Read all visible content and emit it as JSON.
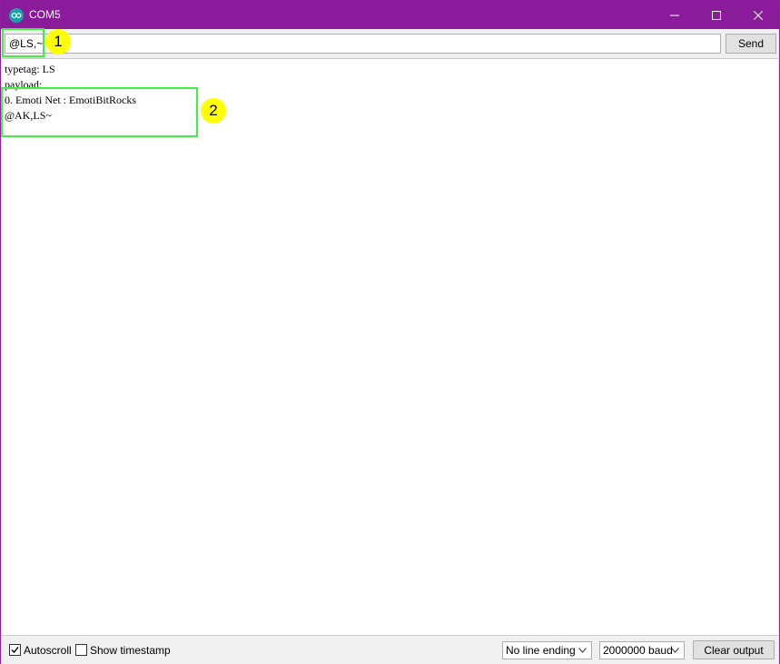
{
  "window": {
    "title": "COM5"
  },
  "input": {
    "value": "@LS,~",
    "send_label": "Send"
  },
  "output": {
    "lines": [
      "typetag: LS",
      "payload:",
      "0. Emoti Net : EmotiBitRocks",
      "@AK,LS~"
    ]
  },
  "statusbar": {
    "autoscroll_label": "Autoscroll",
    "autoscroll_checked": true,
    "timestamp_label": "Show timestamp",
    "timestamp_checked": false,
    "line_ending": "No line ending",
    "baud": "2000000 baud",
    "clear_label": "Clear output"
  },
  "annotations": {
    "marker1": "1",
    "marker2": "2",
    "highlight_color": "#3df23d",
    "marker_color": "#ffff00"
  },
  "colors": {
    "titlebar": "#8a1c9c",
    "app_icon": "#19a3a8"
  }
}
